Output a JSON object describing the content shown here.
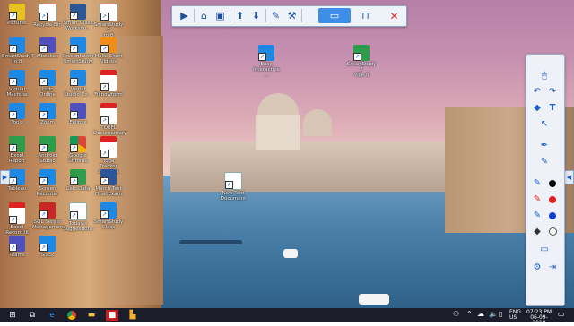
{
  "desktop": {
    "icons_left": [
      {
        "label": "Pictures",
        "icon": "folder-icon",
        "type": "ic-yellow"
      },
      {
        "label": "Recycle Bin",
        "icon": "recycle-bin-icon",
        "type": "ic-doc"
      },
      {
        "label": "Smart Class\nWorksho...",
        "icon": "word-doc-icon",
        "type": "ic-word"
      },
      {
        "label": "SmartStudy 7\nto 8",
        "icon": "document-icon",
        "type": "ic-doc"
      },
      {
        "label": "SmartStudy7\nto 8",
        "icon": "shortcut-icon",
        "type": "ic-blue"
      },
      {
        "label": "Mistakes",
        "icon": "app-icon",
        "type": "ic-purple"
      },
      {
        "label": "Presentation\nSmartStudy",
        "icon": "app-icon",
        "type": "ic-blue"
      },
      {
        "label": "Make Short\nVideos",
        "icon": "app-icon",
        "type": "ic-orange"
      },
      {
        "label": "Virtual\nMachine",
        "icon": "app-icon",
        "type": "ic-blue"
      },
      {
        "label": "Ludo\nOnline",
        "icon": "app-icon",
        "type": "ic-blue"
      },
      {
        "label": "Visual\nStudio Co...",
        "icon": "vscode-icon",
        "type": "ic-blue"
      },
      {
        "label": "Fillnowform",
        "icon": "pdf-icon",
        "type": "ic-pdf"
      },
      {
        "label": "Tools",
        "icon": "app-icon",
        "type": "ic-blue"
      },
      {
        "label": "Zoom",
        "icon": "app-icon",
        "type": "ic-blue"
      },
      {
        "label": "Eclipse",
        "icon": "app-icon",
        "type": "ic-purple"
      },
      {
        "label": "TOEFL\nDocumentary",
        "icon": "pdf-icon",
        "type": "ic-pdf"
      },
      {
        "label": "Excel Report",
        "icon": "excel-icon",
        "type": "ic-green"
      },
      {
        "label": "Android\nStudio",
        "icon": "app-icon",
        "type": "ic-green"
      },
      {
        "label": "Google\nChrome",
        "icon": "chrome-icon",
        "type": "ic-chrome"
      },
      {
        "label": "Yoga Tracker\nsamples",
        "icon": "pdf-icon",
        "type": "ic-pdf"
      },
      {
        "label": "Tableau",
        "icon": "app-icon",
        "type": "ic-blue"
      },
      {
        "label": "Screen\nRecorder",
        "icon": "app-icon",
        "type": "ic-blue"
      },
      {
        "label": "Calc Data",
        "icon": "app-icon",
        "type": "ic-green"
      },
      {
        "label": "Match Test\nFinal Exam",
        "icon": "word-doc-icon",
        "type": "ic-word"
      },
      {
        "label": "Excel\nRecord III",
        "icon": "pdf-icon",
        "type": "ic-pdf"
      },
      {
        "label": "SQL Server\nManagement",
        "icon": "app-icon",
        "type": "ic-red"
      },
      {
        "label": "Today's\nSuggestions",
        "icon": "document-icon",
        "type": "ic-doc"
      },
      {
        "label": "SmartStudy\nClass",
        "icon": "app-icon",
        "type": "ic-blue"
      },
      {
        "label": "Teams",
        "icon": "app-icon",
        "type": "ic-purple"
      },
      {
        "label": "Slack",
        "icon": "app-icon",
        "type": "ic-blue"
      }
    ],
    "icons_center": [
      {
        "label": "Easy\nInteractive ...",
        "icon": "shortcut-icon",
        "type": "ic-blue"
      },
      {
        "label": "SmartStudy 7\nVille 8",
        "icon": "shortcut-icon",
        "type": "ic-green"
      },
      {
        "label": "New Text\nDocument",
        "icon": "text-file-icon",
        "type": "ic-doc"
      }
    ]
  },
  "top_toolbar": {
    "buttons": [
      "play-icon",
      "home-icon",
      "save-icon",
      "arrow-up-icon",
      "arrow-down-icon",
      "toolbox-icon",
      "tools-icon",
      "monitor-icon",
      "desk-icon",
      "close-icon"
    ]
  },
  "taskbar": {
    "language_line1": "ENG",
    "language_line2": "US",
    "time": "07:23 PM",
    "date": "06-09-2019"
  },
  "colors": {
    "accent": "#3e8ee8",
    "taskbar": "#1b1e2a",
    "panel": "#eef2f8"
  }
}
